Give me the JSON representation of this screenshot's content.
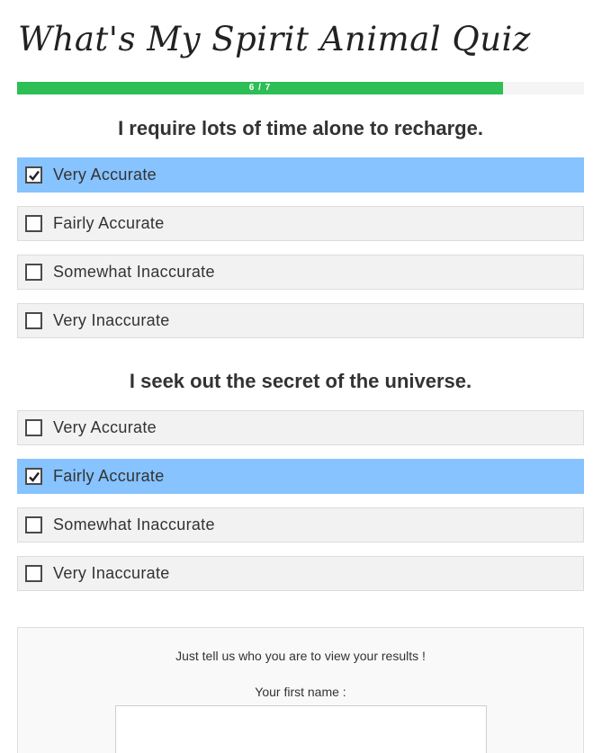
{
  "quiz": {
    "title": "What's My Spirit Animal Quiz",
    "progress": {
      "current": 6,
      "total": 7,
      "label": "6 / 7"
    },
    "colors": {
      "progress": "#2dbe55",
      "selected": "#87c3fe",
      "option": "#f2f2f2"
    }
  },
  "questions": [
    {
      "text": "I require lots of time alone to recharge.",
      "options": [
        {
          "label": "Very Accurate",
          "selected": true
        },
        {
          "label": "Fairly Accurate",
          "selected": false
        },
        {
          "label": "Somewhat Inaccurate",
          "selected": false
        },
        {
          "label": "Very Inaccurate",
          "selected": false
        }
      ]
    },
    {
      "text": "I seek out the secret of the universe.",
      "options": [
        {
          "label": "Very Accurate",
          "selected": false
        },
        {
          "label": "Fairly Accurate",
          "selected": true
        },
        {
          "label": "Somewhat Inaccurate",
          "selected": false
        },
        {
          "label": "Very Inaccurate",
          "selected": false
        }
      ]
    }
  ],
  "results": {
    "prompt": "Just tell us who you are to view your results !",
    "name_label": "Your first name :",
    "name_value": ""
  }
}
